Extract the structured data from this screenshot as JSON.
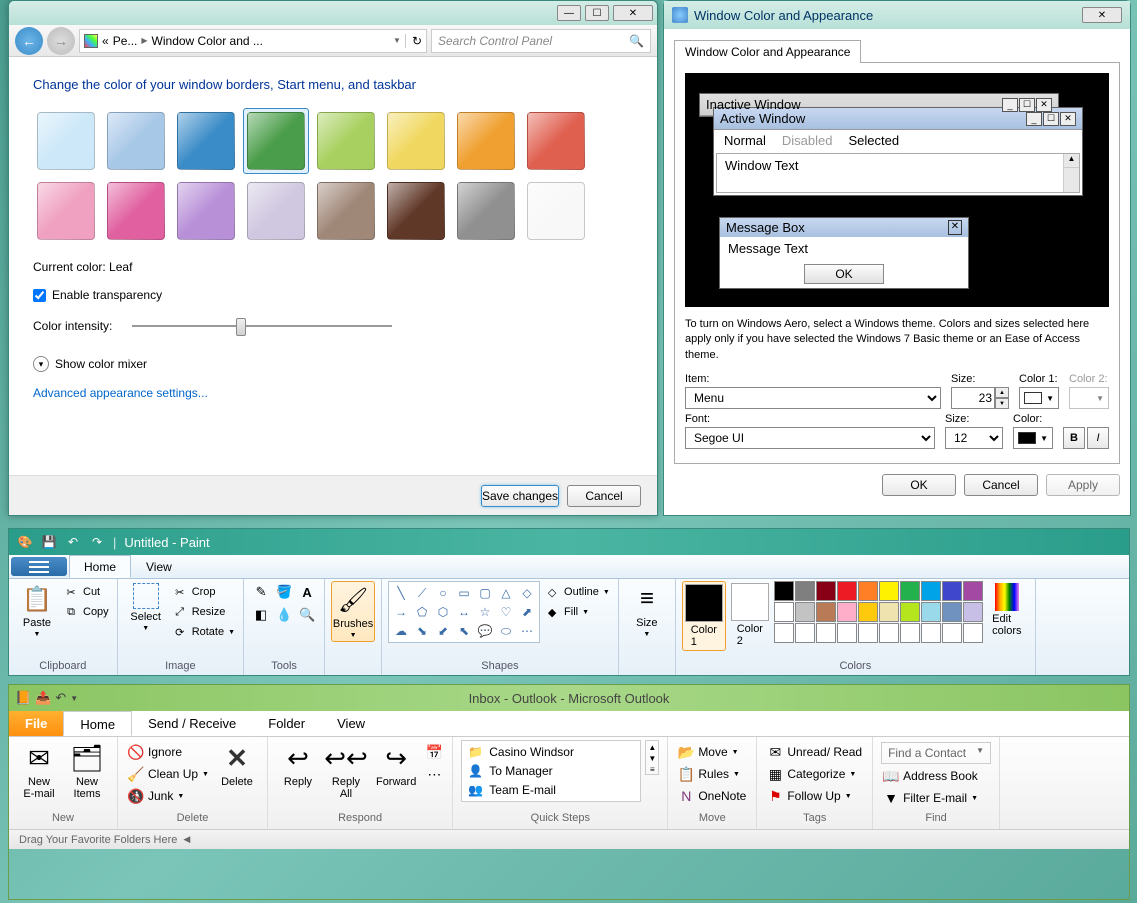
{
  "win1": {
    "breadcrumb_prefix": "«",
    "breadcrumb_1": "Pe...",
    "breadcrumb_2": "Window Color and ...",
    "search_ph": "Search Control Panel",
    "heading": "Change the color of your window borders, Start menu, and taskbar",
    "swatches": [
      "#cde8f8",
      "#a8c8e8",
      "#3a8cc8",
      "#4a9d4a",
      "#a8d060",
      "#f0d860",
      "#f0a030",
      "#e06050",
      "#f0a0c0",
      "#e060a0",
      "#b890d8",
      "#d0c8e0",
      "#a08878",
      "#603828",
      "#909090",
      "#f8f8f8"
    ],
    "selected_index": 3,
    "current_color_label": "Current color:",
    "current_color_value": "Leaf",
    "transparency_label": "Enable transparency",
    "intensity_label": "Color intensity:",
    "mixer_label": "Show color mixer",
    "adv_link": "Advanced appearance settings...",
    "save_btn": "Save changes",
    "cancel_btn": "Cancel"
  },
  "win2": {
    "title": "Window Color and Appearance",
    "tab": "Window Color and Appearance",
    "pv_inactive": "Inactive Window",
    "pv_active": "Active Window",
    "pv_normal": "Normal",
    "pv_disabled": "Disabled",
    "pv_selected": "Selected",
    "pv_wintext": "Window Text",
    "pv_msgbox": "Message Box",
    "pv_msgtext": "Message Text",
    "pv_ok": "OK",
    "note": "To turn on Windows Aero, select a Windows theme.  Colors and sizes selected here apply only if you have selected the Windows 7 Basic theme or an Ease of Access theme.",
    "item_lbl": "Item:",
    "item_val": "Menu",
    "size_lbl": "Size:",
    "size_val": "23",
    "color1_lbl": "Color 1:",
    "color2_lbl": "Color 2:",
    "font_lbl": "Font:",
    "font_val": "Segoe UI",
    "fsize_lbl": "Size:",
    "fsize_val": "12",
    "fcolor_lbl": "Color:",
    "bold": "B",
    "italic": "I",
    "ok": "OK",
    "cancel": "Cancel",
    "apply": "Apply"
  },
  "win3": {
    "title": "Untitled - Paint",
    "tab_home": "Home",
    "tab_view": "View",
    "paste": "Paste",
    "cut": "Cut",
    "copy": "Copy",
    "select": "Select",
    "crop": "Crop",
    "resize": "Resize",
    "rotate": "Rotate",
    "brushes": "Brushes",
    "outline": "Outline",
    "fill": "Fill",
    "size": "Size",
    "color1": "Color\n1",
    "color2": "Color\n2",
    "editcolors": "Edit\ncolors",
    "g_clipboard": "Clipboard",
    "g_image": "Image",
    "g_tools": "Tools",
    "g_shapes": "Shapes",
    "g_colors": "Colors",
    "palette": [
      "#000000",
      "#7f7f7f",
      "#880015",
      "#ed1c24",
      "#ff7f27",
      "#fff200",
      "#22b14c",
      "#00a2e8",
      "#3f48cc",
      "#a349a4",
      "#ffffff",
      "#c3c3c3",
      "#b97a57",
      "#ffaec9",
      "#ffc90e",
      "#efe4b0",
      "#b5e61d",
      "#99d9ea",
      "#7092be",
      "#c8bfe7"
    ]
  },
  "win4": {
    "title": "Inbox - Outlook  -  Microsoft Outlook",
    "tab_file": "File",
    "tab_home": "Home",
    "tab_sr": "Send / Receive",
    "tab_folder": "Folder",
    "tab_view": "View",
    "new_email": "New\nE-mail",
    "new_items": "New\nItems",
    "ignore": "Ignore",
    "cleanup": "Clean Up",
    "junk": "Junk",
    "delete": "Delete",
    "reply": "Reply",
    "replyall": "Reply\nAll",
    "forward": "Forward",
    "qs1": "Casino Windsor",
    "qs2": "To Manager",
    "qs3": "Team E-mail",
    "move": "Move",
    "rules": "Rules",
    "onenote": "OneNote",
    "unread": "Unread/ Read",
    "categorize": "Categorize",
    "followup": "Follow Up",
    "findcontact": "Find a Contact",
    "addressbook": "Address Book",
    "filteremail": "Filter E-mail",
    "g_new": "New",
    "g_delete": "Delete",
    "g_respond": "Respond",
    "g_qs": "Quick Steps",
    "g_move": "Move",
    "g_tags": "Tags",
    "g_find": "Find",
    "status": "Drag Your Favorite Folders Here"
  }
}
